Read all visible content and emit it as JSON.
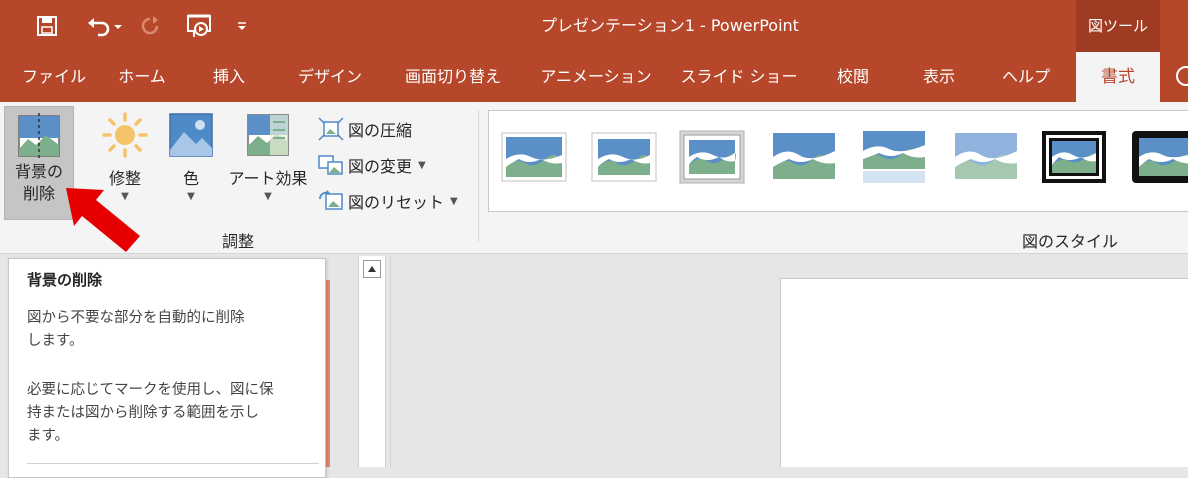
{
  "window": {
    "title": "プレゼンテーション1  -  PowerPoint",
    "context_tab_group": "図ツール"
  },
  "tabs": [
    {
      "label": "ファイル"
    },
    {
      "label": "ホーム"
    },
    {
      "label": "挿入"
    },
    {
      "label": "デザイン"
    },
    {
      "label": "画面切り替え"
    },
    {
      "label": "アニメーション"
    },
    {
      "label": "スライド ショー"
    },
    {
      "label": "校閲"
    },
    {
      "label": "表示"
    },
    {
      "label": "ヘルプ"
    },
    {
      "label": "書式",
      "active": true
    }
  ],
  "ribbon": {
    "adjust": {
      "remove_bg_line1": "背景の",
      "remove_bg_line2": "削除",
      "corrections": "修整",
      "color": "色",
      "artistic": "アート効果",
      "compress": "図の圧縮",
      "change": "図の変更",
      "reset": "図のリセット",
      "group_label": "調整"
    },
    "styles": {
      "group_label": "図のスタイル"
    }
  },
  "tooltip": {
    "title": "背景の削除",
    "body1_line1": "図から不要な部分を自動的に削除",
    "body1_line2": "します。",
    "body2_line1": "必要に応じてマークを使用し、図に保",
    "body2_line2": "持または図から削除する範囲を示し",
    "body2_line3": "ます。"
  },
  "colors": {
    "accent": "#b7472a",
    "ribbon": "#f4f4f4",
    "arrow": "#e60000",
    "slide_accent": "#e2866b"
  }
}
